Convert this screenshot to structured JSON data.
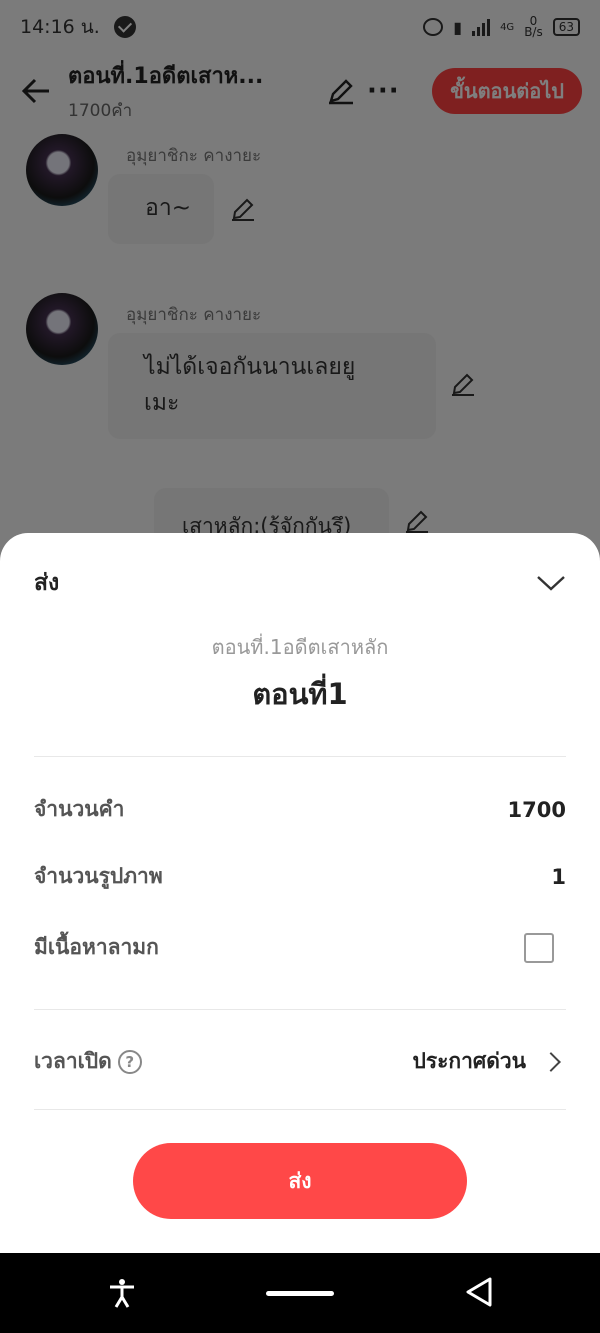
{
  "status_bar": {
    "time": "14:16 น.",
    "net_rate_value": "0",
    "net_rate_unit": "B/s",
    "network": "4G",
    "battery": "63"
  },
  "header": {
    "title": "ตอนที่.1อดีตเสาห...",
    "word_count": "1700คำ",
    "next_button": "ขั้นตอนต่อไป"
  },
  "chat": {
    "messages": [
      {
        "name": "อุมุยาชิกะ คางายะ",
        "text": "อา~"
      },
      {
        "name": "อุมุยาชิกะ คางายะ",
        "text_line1": "ไม่ได้เจอกันนานเลยยู",
        "text_line2": "เมะ"
      },
      {
        "text": "เสาหลัก:(รู้จักกันรึ)"
      }
    ]
  },
  "sheet": {
    "title": "ส่ง",
    "episode_title": "ตอนที่.1อดีตเสาหลัก",
    "episode_name": "ตอนที่1",
    "rows": {
      "word_count_label": "จำนวนคำ",
      "word_count_value": "1700",
      "image_count_label": "จำนวนรูปภาพ",
      "image_count_value": "1",
      "adult_label": "มีเนื้อหาลามก",
      "adult_checked": false,
      "open_time_label": "เวลาเปิด",
      "help_glyph": "?",
      "open_time_value": "ประกาศด่วน"
    },
    "send_button": "ส่ง"
  },
  "colors": {
    "accent": "#ff4848",
    "overlay": "rgba(0,0,0,0.5)",
    "navbar": "#000000"
  }
}
